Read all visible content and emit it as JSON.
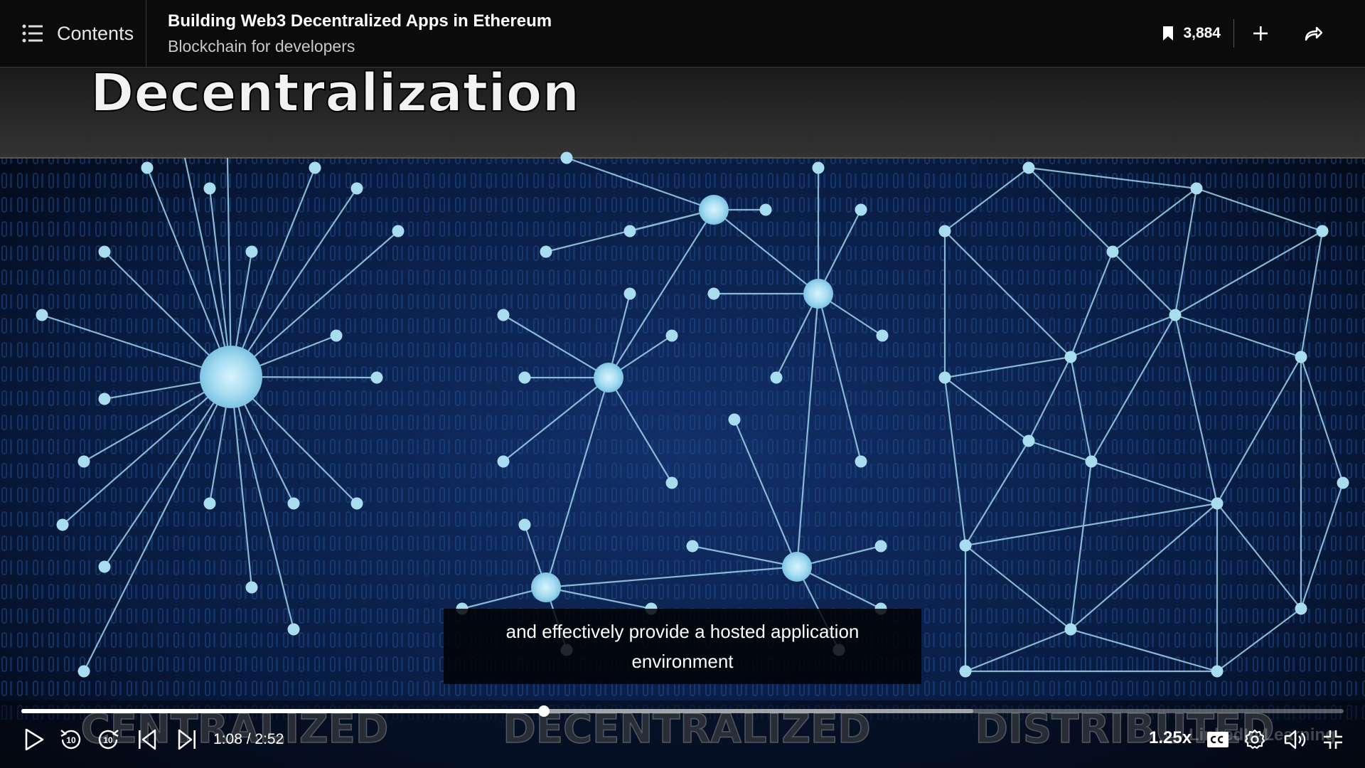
{
  "header": {
    "contents_label": "Contents",
    "course_title": "Building Web3 Decentralized Apps in Ethereum",
    "course_subtitle": "Blockchain for developers",
    "bookmark_count": "3,884"
  },
  "video": {
    "slide_title": "Decentralization",
    "panel_labels": [
      "CENTRALIZED",
      "DECENTRALIZED",
      "DISTRIBUTED"
    ],
    "watermark": "LinkedIn Learning",
    "caption": "and effectively provide a hosted application environment",
    "colors": {
      "background": "#06142e",
      "node": "#a8ddf0",
      "line": "#9fd3ea",
      "header_band": "#2e2e2e"
    }
  },
  "controls": {
    "time_text": "1:08 / 2:52",
    "elapsed_seconds": 68,
    "duration_seconds": 172,
    "buffered_fraction": 0.72,
    "speed_label": "1.25x",
    "skip_seconds": "10",
    "icons": [
      "play-icon",
      "rewind-10-icon",
      "forward-10-icon",
      "previous-icon",
      "next-icon",
      "captions-icon",
      "settings-icon",
      "volume-icon",
      "exit-fullscreen-icon"
    ]
  }
}
